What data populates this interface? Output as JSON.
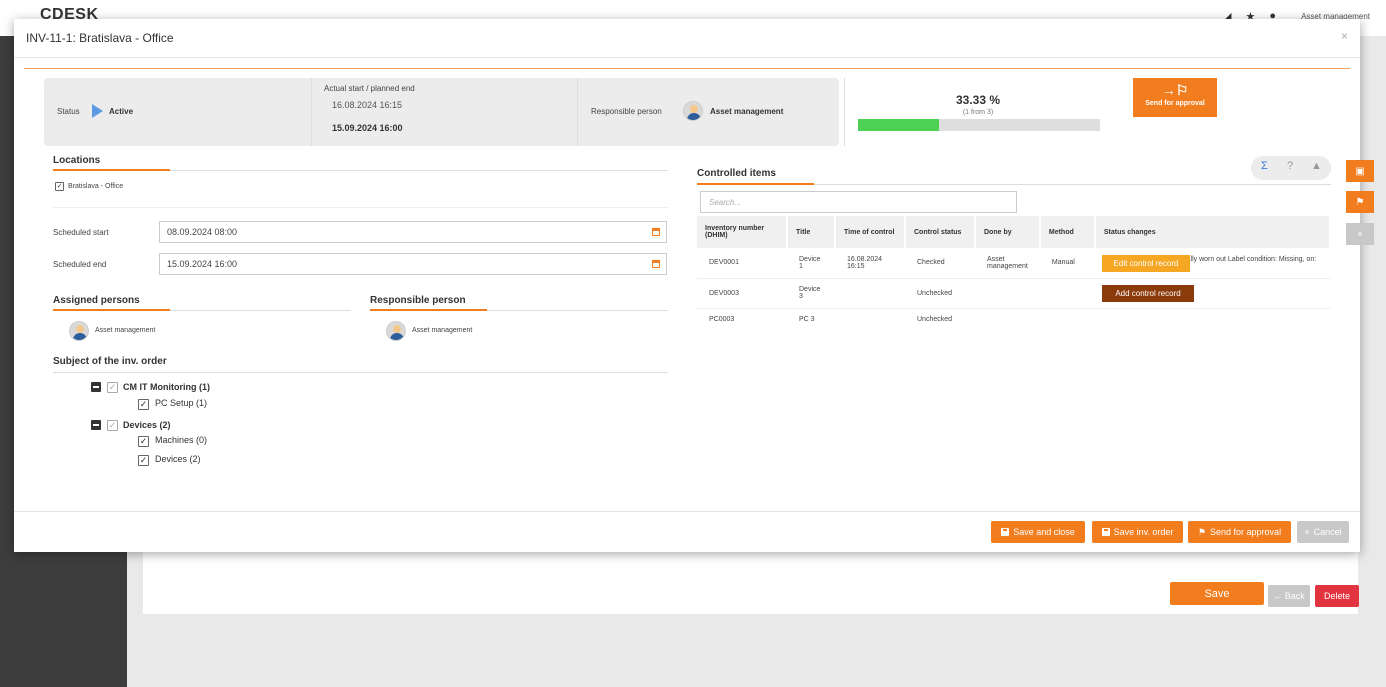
{
  "app": {
    "logo": "CDESK",
    "user": "Asset management"
  },
  "background": {
    "save_label": "Save",
    "back_label": "← Back",
    "delete_label": "Delete"
  },
  "modal": {
    "title": "INV-11-1: Bratislava - Office",
    "close": "×"
  },
  "status": {
    "status_label": "Status",
    "status_value": "Active",
    "dates_label": "Actual start / planned end",
    "actual_start": "16.08.2024 16:15",
    "planned_end": "15.09.2024 16:00",
    "responsible_label": "Responsible person",
    "responsible_value": "Asset management",
    "percent": "33.33 %",
    "percent_sub": "(1 from 3)",
    "progress_fraction": 0.3333,
    "approval_label": "Send for approval"
  },
  "locations": {
    "title": "Locations",
    "item": "Bratislava - Office"
  },
  "schedule": {
    "start_label": "Scheduled start",
    "start_value": "08.09.2024 08:00",
    "end_label": "Scheduled end",
    "end_value": "15.09.2024 16:00"
  },
  "assigned": {
    "title": "Assigned persons",
    "person": "Asset management"
  },
  "responsible": {
    "title": "Responsible person",
    "person": "Asset management"
  },
  "subject": {
    "title": "Subject of the inv. order",
    "groups": [
      {
        "label": "CM IT Monitoring (1)",
        "children": [
          "PC Setup (1)"
        ]
      },
      {
        "label": "Devices (2)",
        "children": [
          "Machines (0)",
          "Devices (2)"
        ]
      }
    ]
  },
  "controlled": {
    "title": "Controlled items",
    "search_placeholder": "Search...",
    "icons": [
      "Σ",
      "?",
      "▲"
    ],
    "columns": [
      "Inventory number (DHIM)",
      "Title",
      "Time of control",
      "Control status",
      "Done by",
      "Method",
      "Status changes"
    ],
    "rows": [
      {
        "inv": "DEV0001",
        "title": "Device 1",
        "time": "16.08.2024 16:15",
        "status": "Checked",
        "done_by": "Asset management",
        "method": "Manual",
        "changes": "Condition: New, on: Normally worn out Label condition: Missing, on: Damaged"
      },
      {
        "inv": "DEV0003",
        "title": "Device 3",
        "time": "",
        "status": "Unchecked",
        "done_by": "",
        "method": "",
        "changes": ""
      },
      {
        "inv": "PC0003",
        "title": "PC 3",
        "time": "",
        "status": "Unchecked",
        "done_by": "",
        "method": "",
        "changes": ""
      }
    ],
    "edit_record": "Edit control record",
    "add_record": "Add control record"
  },
  "footer": {
    "save_close": "Save and close",
    "save_order": "Save inv. order",
    "send_approval": "Send for approval",
    "cancel": "Cancel"
  },
  "colors": {
    "accent": "#f27d1f",
    "progress": "#4cd154",
    "active": "#5c9be2",
    "add_btn": "#8b3a0a",
    "edit_btn": "#f5a623"
  }
}
